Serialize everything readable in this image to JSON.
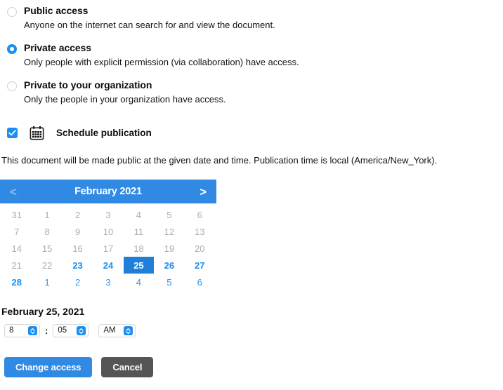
{
  "access": {
    "options": [
      {
        "title": "Public access",
        "description": "Anyone on the internet can search for and view the document.",
        "selected": false
      },
      {
        "title": "Private access",
        "description": "Only people with explicit permission (via collaboration) have access.",
        "selected": true
      },
      {
        "title": "Private to your organization",
        "description": "Only the people in your organization have access.",
        "selected": false
      }
    ]
  },
  "schedule": {
    "checkbox_checked": true,
    "label": "Schedule publication",
    "note": "This document will be made public at the given date and time. Publication time is local (America/New_York).",
    "calendar_icon": "calendar-icon"
  },
  "calendar": {
    "prev_label": "<",
    "next_label": ">",
    "title": "February 2021",
    "selected_day": 25,
    "weeks": [
      [
        {
          "label": "31",
          "state": "adjacent-past"
        },
        {
          "label": "1",
          "state": "adjacent-past"
        },
        {
          "label": "2",
          "state": "adjacent-past"
        },
        {
          "label": "3",
          "state": "adjacent-past"
        },
        {
          "label": "4",
          "state": "adjacent-past"
        },
        {
          "label": "5",
          "state": "adjacent-past"
        },
        {
          "label": "6",
          "state": "adjacent-past"
        }
      ],
      [
        {
          "label": "7",
          "state": "past"
        },
        {
          "label": "8",
          "state": "past"
        },
        {
          "label": "9",
          "state": "past"
        },
        {
          "label": "10",
          "state": "past"
        },
        {
          "label": "11",
          "state": "past"
        },
        {
          "label": "12",
          "state": "past"
        },
        {
          "label": "13",
          "state": "past"
        }
      ],
      [
        {
          "label": "14",
          "state": "past"
        },
        {
          "label": "15",
          "state": "past"
        },
        {
          "label": "16",
          "state": "past"
        },
        {
          "label": "17",
          "state": "past"
        },
        {
          "label": "18",
          "state": "past"
        },
        {
          "label": "19",
          "state": "past"
        },
        {
          "label": "20",
          "state": "past"
        }
      ],
      [
        {
          "label": "21",
          "state": "past"
        },
        {
          "label": "22",
          "state": "past"
        },
        {
          "label": "23",
          "state": "available"
        },
        {
          "label": "24",
          "state": "available"
        },
        {
          "label": "25",
          "state": "selected"
        },
        {
          "label": "26",
          "state": "available"
        },
        {
          "label": "27",
          "state": "available"
        }
      ],
      [
        {
          "label": "28",
          "state": "available"
        },
        {
          "label": "1",
          "state": "adjacent-future"
        },
        {
          "label": "2",
          "state": "adjacent-future"
        },
        {
          "label": "3",
          "state": "adjacent-future"
        },
        {
          "label": "4",
          "state": "adjacent-future"
        },
        {
          "label": "5",
          "state": "adjacent-future"
        },
        {
          "label": "6",
          "state": "adjacent-future"
        }
      ]
    ]
  },
  "chosen": {
    "date_label": "February 25, 2021",
    "hour": "8",
    "separator": ":",
    "minute": "05",
    "meridiem": "AM"
  },
  "footer": {
    "submit_label": "Change access",
    "cancel_label": "Cancel"
  },
  "colors": {
    "accent_blue": "#3089e3",
    "control_blue": "#1b8ef2",
    "selected_day_blue": "#2080d9",
    "disabled_gray": "#adadad",
    "cancel_gray": "#555553"
  }
}
